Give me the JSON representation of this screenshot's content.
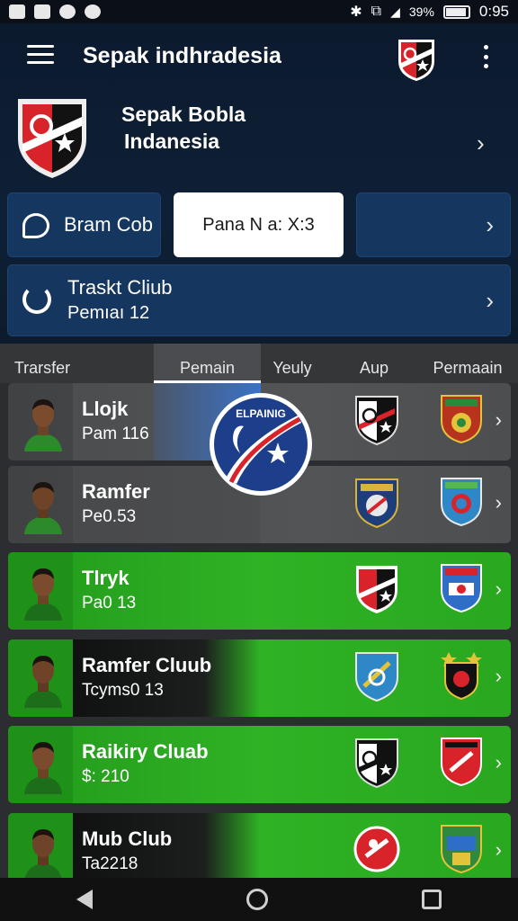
{
  "status_bar": {
    "battery": "39%",
    "time": "0:95"
  },
  "header": {
    "app_title": "Sepak indhradesia",
    "club_name_line1": "Sepak Bobla",
    "club_name_line2": "Indanesia"
  },
  "quick_actions": {
    "bram_label": "Bram Cob",
    "pana_label": "Pana N a: X:3"
  },
  "track_card": {
    "title": "Traskt Cliub",
    "subtitle": "Pemıaı 12"
  },
  "tabs": [
    {
      "label": "Trarsfer"
    },
    {
      "label": "Pemain"
    },
    {
      "label": "Yeuly"
    },
    {
      "label": "Aup"
    },
    {
      "label": "Permaain"
    }
  ],
  "floating_badge_text": "ELPAINIG",
  "players": [
    {
      "name": "Llojk",
      "sub": "Pam 116"
    },
    {
      "name": "Ramfer",
      "sub": "Pe0.53"
    },
    {
      "name": "Tlryk",
      "sub": "Pa0 13"
    },
    {
      "name": "Ramfer Cluub",
      "sub": "Tcyms0 13"
    },
    {
      "name": "Raikiry Cluab",
      "sub": "$: 210"
    },
    {
      "name": "Mub Club",
      "sub": "Ta2218"
    }
  ],
  "colors": {
    "accent_blue": "#15365e",
    "row_green": "#2fb224",
    "crest_red": "#d8232a"
  }
}
